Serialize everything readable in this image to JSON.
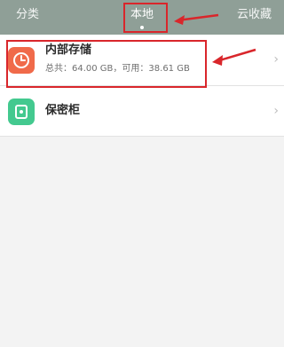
{
  "tabs": [
    {
      "label": "分类"
    },
    {
      "label": "本地"
    },
    {
      "label": "云收藏"
    }
  ],
  "storage_list": [
    {
      "title": "内部存储",
      "subtitle": "总共：64.00 GB，可用：38.61 GB",
      "icon": "storage-clock-icon",
      "color": "#f06a4a"
    },
    {
      "title": "保密柜",
      "icon": "safe-box-icon",
      "color": "#43c98f"
    }
  ],
  "chevron": "›",
  "theme": {
    "topbar": "#8f9f97",
    "annotation": "#d9262b"
  }
}
